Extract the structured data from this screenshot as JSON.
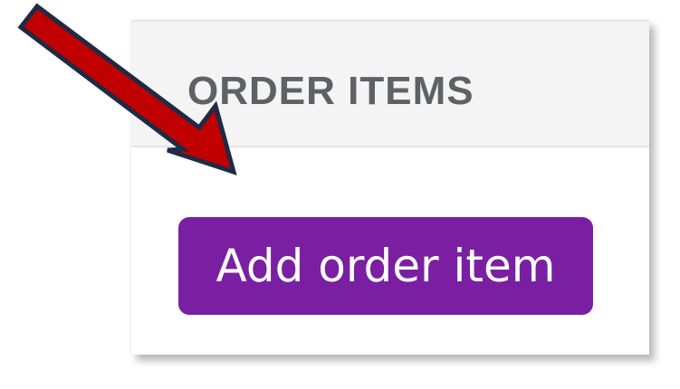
{
  "order_items": {
    "title": "ORDER ITEMS",
    "add_button_label": "Add order item"
  },
  "annotation": {
    "icon": "pointer-arrow-icon",
    "arrow_fill": "#c00000",
    "arrow_outline": "#1f2a44"
  },
  "colors": {
    "button_bg": "#7b1fa2",
    "header_bg": "#f4f4f5",
    "title_text": "#5f6166"
  }
}
